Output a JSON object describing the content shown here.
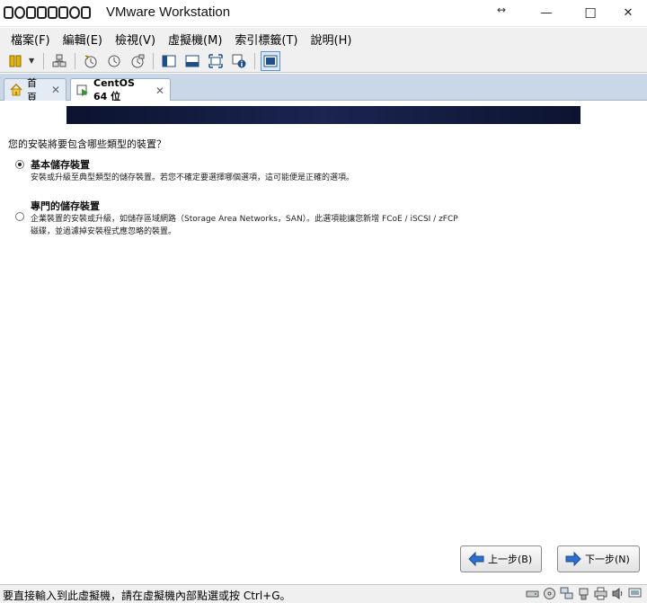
{
  "window": {
    "brand_text": "MOBILE01",
    "title": "VMware Workstation",
    "resize_glyph": "↔",
    "minimize_glyph": "—",
    "maximize_glyph": "☐",
    "close_glyph": "✕"
  },
  "menu": [
    "檔案(F)",
    "編輯(E)",
    "檢視(V)",
    "虛擬機(M)",
    "索引標籤(T)",
    "說明(H)"
  ],
  "tabs": [
    {
      "label": "首頁",
      "icon": "home-icon",
      "active": false
    },
    {
      "label": "CentOS 64 位",
      "icon": "vm-play-icon",
      "active": true
    }
  ],
  "tab_close_glyph": "✕",
  "installer": {
    "question": "您的安裝將要包含哪些類型的裝置？",
    "options": [
      {
        "title": "基本儲存裝置",
        "desc_lines": [
          "安裝或升級至典型類型的儲存裝置。若您不確定要選擇哪個選項，這可能便是正確的選項。"
        ],
        "selected": true
      },
      {
        "title": "專門的儲存裝置",
        "desc_lines": [
          "企業裝置的安裝或升級，如儲存區域網路（Storage Area Networks，SAN）。此選項能讓您新增 FCoE / iSCSI / zFCP",
          "磁碟，並過濾掉安裝程式應忽略的裝置。"
        ],
        "selected": false
      }
    ],
    "back_label": "上一步(B)",
    "next_label": "下一步(N)"
  },
  "status": {
    "text": "要直接輸入到此虛擬機，請在虛擬機內部點選或按 Ctrl+G。"
  },
  "colors": {
    "banner": "#0c1330",
    "tabstrip": "#c9d7e8",
    "arrow_blue": "#2a6fd1"
  }
}
